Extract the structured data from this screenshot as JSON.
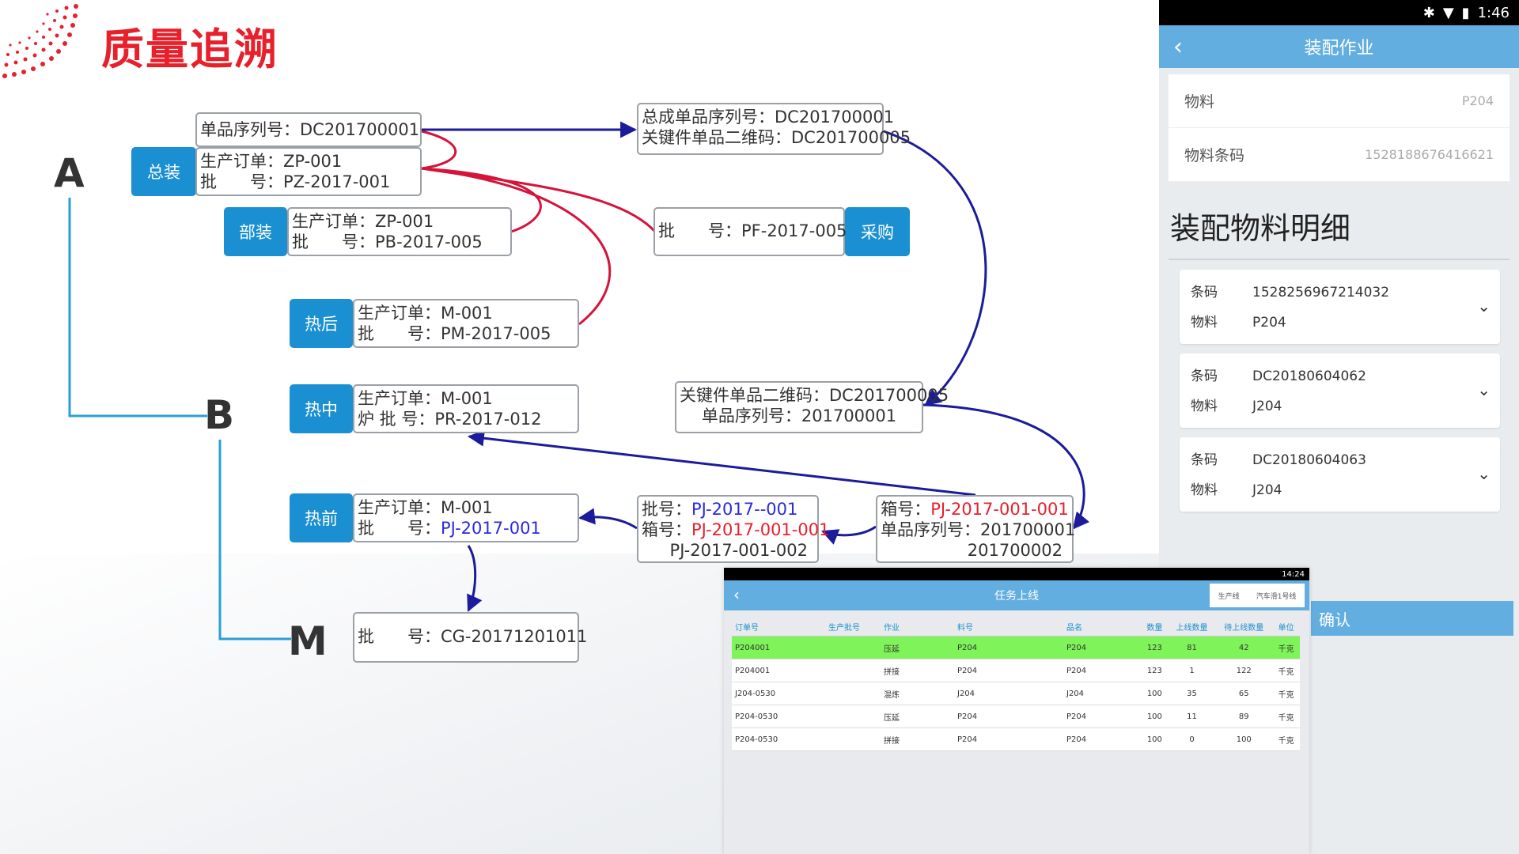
{
  "title": "质量追溯",
  "colors": {
    "accent_red": "#e8202b",
    "tag_blue": "#1a8fd1",
    "arrow_blue": "#1b1b9b",
    "curve_red": "#d4143a",
    "line_blue": "#2a9fd6"
  },
  "letters": {
    "a": "A",
    "b": "B",
    "m": "M"
  },
  "tags": {
    "zongzhuang": "总装",
    "buzhuang": "部装",
    "rehou": "热后",
    "rezhong": "热中",
    "reqian": "热前",
    "caigou": "采购"
  },
  "nodes": {
    "serial": "单品序列号：DC201700001",
    "zz_line1": "生产订单：ZP-001",
    "zz_line2": "批　　号：PZ-2017-001",
    "bz_line1": "生产订单：ZP-001",
    "bz_line2": "批　　号：PB-2017-005",
    "rh_line1": "生产订单：M-001",
    "rh_line2": "批　　号：PM-2017-005",
    "rz_line1": "生产订单：M-001",
    "rz_line2": "炉  批 号：PR-2017-012",
    "rq_line1": "生产订单：M-001",
    "rq_line2_label": "批　　号：",
    "rq_line2_value": "PJ-2017-001",
    "m_line": "批　　号：CG-20171201011",
    "asm_line1": "总成单品序列号：DC201700001",
    "asm_line2": "关键件单品二维码：DC201700005",
    "cg_line": "批　　号：PF-2017-005",
    "key_line1": "关键件单品二维码：DC201700005",
    "key_line2": "单品序列号：201700001",
    "box_line1_label": "箱号：",
    "box_line1_value": "PJ-2017-001-001",
    "box_line2": "单品序列号：201700001",
    "box_line3": "201700002",
    "mid_line1_label": "批号：",
    "mid_line1_value": "PJ-2017--001",
    "mid_line2_label": "箱号：",
    "mid_line2_value": "PJ-2017-001-001",
    "mid_line3": "PJ-2017-001-002"
  },
  "phone": {
    "time": "1:46",
    "title": "装配作业",
    "fields": [
      {
        "label": "物料",
        "value": "P204"
      },
      {
        "label": "物料条码",
        "value": "1528188676416621"
      }
    ],
    "section_title": "装配物料明细",
    "items": [
      {
        "k1": "条码",
        "v1": "1528256967214032",
        "k2": "物料",
        "v2": "P204"
      },
      {
        "k1": "条码",
        "v1": "DC20180604062",
        "k2": "物料",
        "v2": "J204"
      },
      {
        "k1": "条码",
        "v1": "DC20180604063",
        "k2": "物料",
        "v2": "J204"
      }
    ],
    "confirm": "确认"
  },
  "tablet": {
    "time": "14:24",
    "title": "任务上线",
    "line_label": "生产线",
    "line_value": "汽车滑1号线",
    "headers": [
      "订单号",
      "生产批号",
      "作业",
      "料号",
      "品名",
      "数量",
      "上线数量",
      "待上线数量",
      "单位"
    ],
    "rows": [
      [
        "P204001",
        "",
        "压延",
        "P204",
        "P204",
        "123",
        "81",
        "42",
        "千克"
      ],
      [
        "P204001",
        "",
        "拼接",
        "P204",
        "P204",
        "123",
        "1",
        "122",
        "千克"
      ],
      [
        "J204-0530",
        "",
        "混炼",
        "J204",
        "J204",
        "100",
        "35",
        "65",
        "千克"
      ],
      [
        "P204-0530",
        "",
        "压延",
        "P204",
        "P204",
        "100",
        "11",
        "89",
        "千克"
      ],
      [
        "P204-0530",
        "",
        "拼接",
        "P204",
        "P204",
        "100",
        "0",
        "100",
        "千克"
      ]
    ]
  }
}
